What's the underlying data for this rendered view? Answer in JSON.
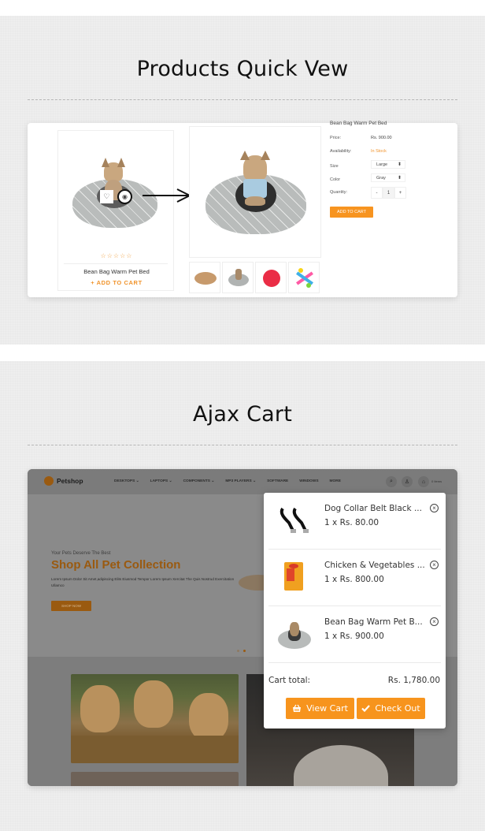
{
  "quick_view": {
    "section_title": "Products Quick Vew",
    "product_card": {
      "rating_stars": "☆☆☆☆☆",
      "name": "Bean Bag Warm Pet Bed",
      "add_to_cart": "+ ADD TO CART",
      "wishlist_icon": "heart-icon",
      "quickview_icon": "eye-icon"
    },
    "details": {
      "title": "Bean Bag Warm Pet Bed",
      "price_label": "Price:",
      "price": "Rs. 900.00",
      "availability_label": "Availability:",
      "availability": "In Stock",
      "size_label": "Size",
      "size_value": "Large",
      "color_label": "Color",
      "color_value": "Gray",
      "quantity_label": "Quantity:",
      "qty_minus": "-",
      "qty_value": "1",
      "qty_plus": "+",
      "add_to_cart": "ADD TO CART",
      "select_arrow": "⬍"
    }
  },
  "ajax_cart": {
    "section_title": "Ajax Cart",
    "header": {
      "logo": "Petshop",
      "nav": [
        "DESKTOPS ⌄",
        "LAPTOPS ⌄",
        "COMPONENTS ⌄",
        "MP3 PLAYERS ⌄",
        "SOFTWARE",
        "WINDOWS",
        "MORE"
      ],
      "items_count": "0 Items"
    },
    "hero": {
      "subtitle": "Your Pets Deserve The Best",
      "title": "Shop All Pet Collection",
      "description": "Lorem Ipsum Dolor Sit Amet,adipiscing Elits Eiusmod Tempor Lorem Ipsum Xercitat The Quis Nostrud Exercitation Ullamco",
      "button": "SHOP NOW"
    },
    "cart": {
      "items": [
        {
          "name": "Dog Collar Belt Black ...",
          "price": "1 x Rs. 80.00"
        },
        {
          "name": "Chicken & Vegetables ...",
          "price": "1 x Rs. 800.00"
        },
        {
          "name": "Bean Bag Warm Pet B...",
          "price": "1 x Rs. 900.00"
        }
      ],
      "remove_glyph": "×",
      "total_label": "Cart total:",
      "total_value": "Rs. 1,780.00",
      "view_cart": "View Cart",
      "check_out": "Check Out"
    }
  },
  "colors": {
    "accent": "#f7941d",
    "in_stock": "#f0932b",
    "overlay_brand": "#9a5a10"
  }
}
